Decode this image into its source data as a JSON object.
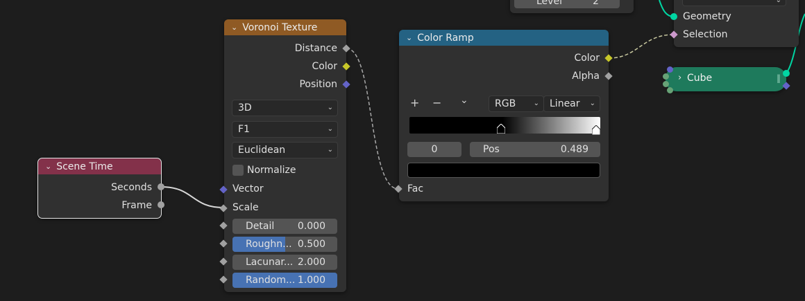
{
  "voronoi": {
    "title": "Voronoi Texture",
    "outputs": [
      "Distance",
      "Color",
      "Position"
    ],
    "dimensions": "3D",
    "feature": "F1",
    "metric": "Euclidean",
    "normalize_label": "Normalize",
    "inputs": {
      "vector": "Vector",
      "scale": "Scale"
    },
    "detail": {
      "label": "Detail",
      "value": "0.000",
      "fill": 0.0
    },
    "roughness": {
      "label": "Roughn...",
      "value": "0.500",
      "fill": 0.5
    },
    "lacunarity": {
      "label": "Lacunar...",
      "value": "2.000",
      "fill": 0.0
    },
    "randomness": {
      "label": "Random...",
      "value": "1.000",
      "fill": 1.0
    }
  },
  "scene_time": {
    "title": "Scene Time",
    "outputs": [
      "Seconds",
      "Frame"
    ]
  },
  "color_ramp": {
    "title": "Color Ramp",
    "outputs": [
      "Color",
      "Alpha"
    ],
    "add_symbol": "+",
    "remove_symbol": "−",
    "menu_symbol": "⌄",
    "color_mode": "RGB",
    "interpolation": "Linear",
    "stop_index": "0",
    "pos_label": "Pos",
    "pos_value": "0.489",
    "input": "Fac",
    "stop_positions": [
      0.489,
      1.0
    ]
  },
  "top_node": {
    "level_label": "Level",
    "level_value": "2",
    "geometry_label": "Geometry",
    "selection_label": "Selection"
  },
  "cube_node": {
    "label": "Cube"
  },
  "colors": {
    "voronoi_header": "#8f5a24",
    "scene_time_header": "#83314a",
    "color_ramp_header": "#246283",
    "cube_node": "#1e7a5c"
  }
}
